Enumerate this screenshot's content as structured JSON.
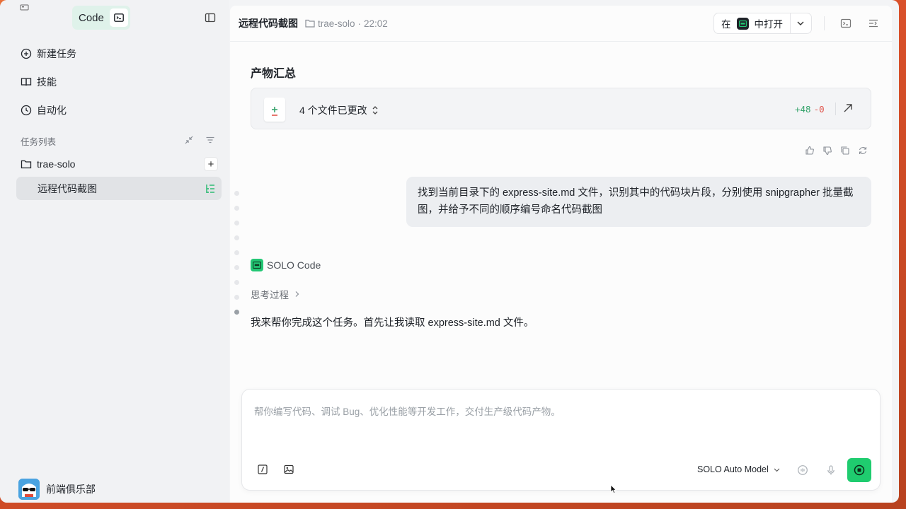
{
  "sidebar": {
    "mode_label": "Code",
    "nav": [
      {
        "label": "新建任务",
        "icon": "plus-circle-icon"
      },
      {
        "label": "技能",
        "icon": "book-icon"
      },
      {
        "label": "自动化",
        "icon": "clock-icon"
      }
    ],
    "section_title": "任务列表",
    "folder": "trae-solo",
    "active_task": "远程代码截图",
    "user_name": "前端俱乐部"
  },
  "header": {
    "title": "远程代码截图",
    "folder": "trae-solo",
    "separator": "·",
    "time": "22:02",
    "open_in_prefix": "在",
    "open_in_suffix": "中打开"
  },
  "artifacts": {
    "title": "产物汇总",
    "files_label": "4 个文件已更改",
    "additions": "+48",
    "deletions": "-0"
  },
  "conversation": {
    "user_message": "找到当前目录下的 express-site.md 文件，识别其中的代码块片段，分别使用 snipgrapher 批量截图，并给予不同的顺序编号命名代码截图",
    "assistant_name": "SOLO Code",
    "thinking_label": "思考过程",
    "assistant_reply": "我来帮你完成这个任务。首先让我读取 express-site.md 文件。"
  },
  "composer": {
    "placeholder": "帮你编写代码、调试 Bug、优化性能等开发工作，交付生产级代码产物。",
    "model": "SOLO Auto Model"
  },
  "colors": {
    "accent": "#1fcc6f",
    "add": "#36a46c",
    "delete": "#e0534a"
  }
}
